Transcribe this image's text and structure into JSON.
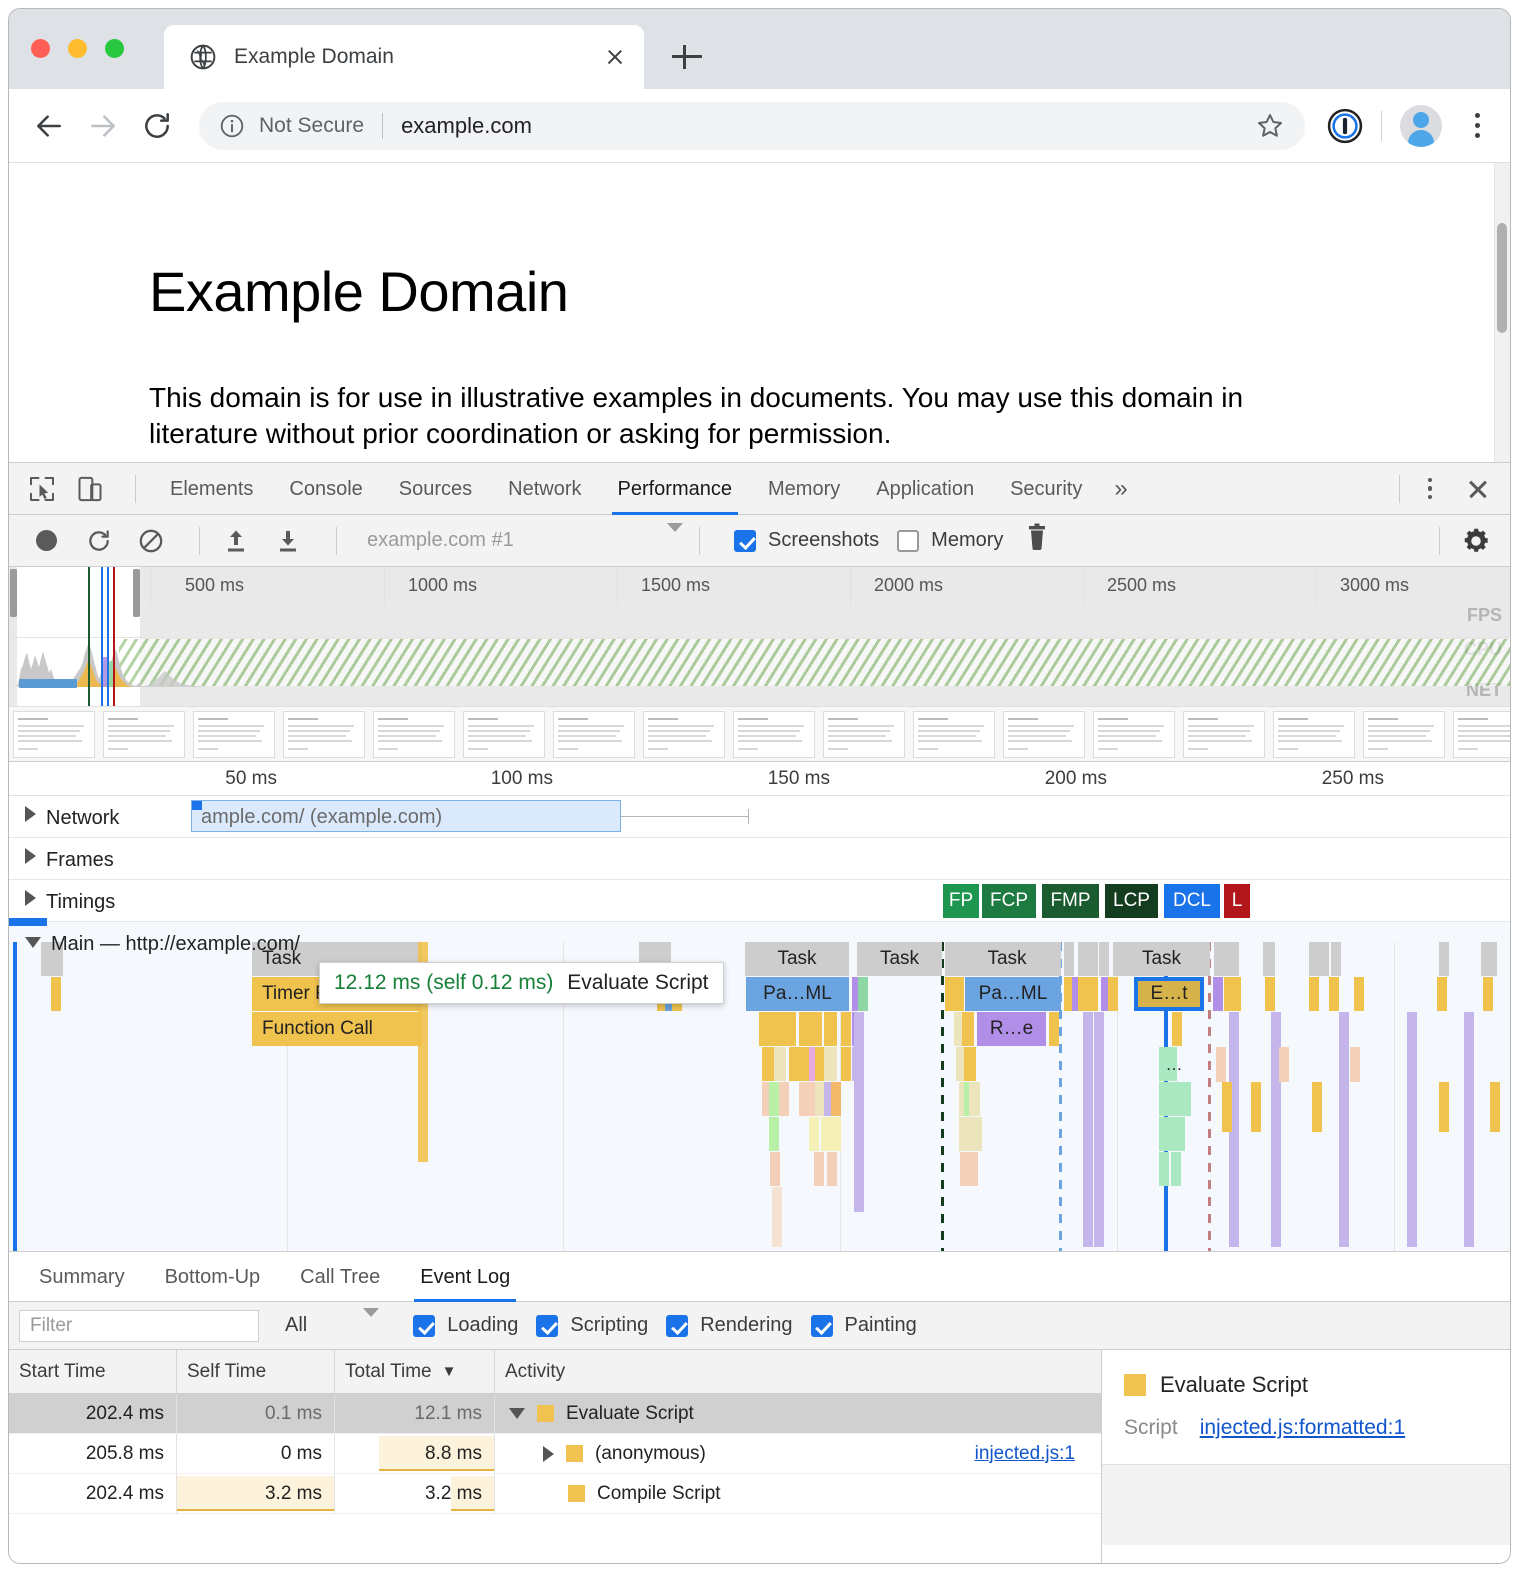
{
  "browser": {
    "tab": {
      "title": "Example Domain",
      "favicon": "globe-icon",
      "close": "×"
    },
    "newtab_label": "+",
    "omnibox": {
      "security_text": "Not Secure",
      "url": "example.com",
      "info_icon": "info-circle-icon",
      "star_icon": "star-icon"
    },
    "extension_icon": "1password-icon",
    "profile_icon": "avatar-icon",
    "menu_icon": "kebab-menu-icon"
  },
  "page": {
    "heading": "Example Domain",
    "paragraph": "This domain is for use in illustrative examples in documents. You may use this domain in literature without prior coordination or asking for permission."
  },
  "devtools": {
    "tabs": [
      {
        "label": "Elements",
        "active": false
      },
      {
        "label": "Console",
        "active": false
      },
      {
        "label": "Sources",
        "active": false
      },
      {
        "label": "Network",
        "active": false
      },
      {
        "label": "Performance",
        "active": true
      },
      {
        "label": "Memory",
        "active": false
      },
      {
        "label": "Application",
        "active": false
      },
      {
        "label": "Security",
        "active": false
      }
    ],
    "more_tabs": "»",
    "inspect_icon": "inspect-element-icon",
    "device_icon": "device-toolbar-icon",
    "toolbar": {
      "record_icon": "record-icon",
      "reload_icon": "reload-record-icon",
      "clear_icon": "clear-icon",
      "upload_icon": "load-profile-icon",
      "download_icon": "save-profile-icon",
      "profile_name": "example.com #1",
      "screenshots_label": "Screenshots",
      "screenshots_checked": true,
      "memory_label": "Memory",
      "memory_checked": false,
      "trash_icon": "trash-icon",
      "settings_icon": "gear-icon"
    }
  },
  "overview": {
    "ticks": [
      "500 ms",
      "1000 ms",
      "1500 ms",
      "2000 ms",
      "2500 ms",
      "3000 ms"
    ],
    "bands": [
      "FPS",
      "CPU",
      "NET"
    ]
  },
  "flamechart": {
    "ticks": [
      "50 ms",
      "100 ms",
      "150 ms",
      "200 ms",
      "250 ms"
    ],
    "tracks": [
      {
        "name": "Network",
        "label": "Network",
        "expanded": false
      },
      {
        "name": "Frames",
        "label": "Frames",
        "expanded": false
      },
      {
        "name": "Timings",
        "label": "Timings",
        "expanded": false
      },
      {
        "name": "Main",
        "label": "Main — http://example.com/",
        "expanded": true
      }
    ],
    "network_request_label": "ample.com/ (example.com)",
    "timing_markers": [
      {
        "label": "FP",
        "color": "#1f9650"
      },
      {
        "label": "FCP",
        "color": "#1d7a40"
      },
      {
        "label": "FMP",
        "color": "#1a5c30"
      },
      {
        "label": "LCP",
        "color": "#143d20"
      },
      {
        "label": "DCL",
        "color": "#1a73e8"
      },
      {
        "label": "L",
        "color": "#b3161a"
      }
    ],
    "blocks": [
      {
        "label": "Task",
        "color": "#cdcdcd"
      },
      {
        "label": "Timer Fired",
        "color": "#f0c24e"
      },
      {
        "label": "Function Call",
        "color": "#f0c24e"
      },
      {
        "label": "Pa…ML",
        "color": "#6ba4e0"
      },
      {
        "label": "R…e",
        "color": "#b18fe8"
      },
      {
        "label": "E…t",
        "color": "#d6b24a"
      }
    ],
    "tooltip": {
      "duration": "12.12 ms (self 0.12 ms)",
      "name": "Evaluate Script"
    }
  },
  "drawer": {
    "tabs": [
      {
        "label": "Summary",
        "active": false
      },
      {
        "label": "Bottom-Up",
        "active": false
      },
      {
        "label": "Call Tree",
        "active": false
      },
      {
        "label": "Event Log",
        "active": true
      }
    ],
    "filter": {
      "placeholder": "Filter",
      "value": "",
      "duration_label": "All",
      "categories": [
        {
          "label": "Loading",
          "checked": true
        },
        {
          "label": "Scripting",
          "checked": true
        },
        {
          "label": "Rendering",
          "checked": true
        },
        {
          "label": "Painting",
          "checked": true
        }
      ]
    },
    "table": {
      "columns": [
        "Start Time",
        "Self Time",
        "Total Time",
        "Activity"
      ],
      "sorted_column": "Total Time",
      "sort_indicator": "▼",
      "rows": [
        {
          "start_time": "202.4 ms",
          "self_time": "0.1 ms",
          "total_time": "12.1 ms",
          "activity": "Evaluate Script",
          "link": "",
          "selected": true,
          "expanded": true,
          "indent": 0,
          "self_bar": 0.0,
          "total_bar": 0.0
        },
        {
          "start_time": "205.8 ms",
          "self_time": "0 ms",
          "total_time": "8.8 ms",
          "activity": "(anonymous)",
          "link": "injected.js:1",
          "selected": false,
          "expanded": false,
          "indent": 1,
          "self_bar": 0.0,
          "total_bar": 0.73
        },
        {
          "start_time": "202.4 ms",
          "self_time": "3.2 ms",
          "total_time": "3.2 ms",
          "activity": "Compile Script",
          "link": "",
          "selected": false,
          "expanded": null,
          "indent": 1,
          "self_bar": 1.0,
          "total_bar": 0.27
        }
      ]
    },
    "details": {
      "title": "Evaluate Script",
      "swatch_color": "#f0c250",
      "script_key": "Script",
      "script_value": "injected.js:formatted:1"
    }
  }
}
